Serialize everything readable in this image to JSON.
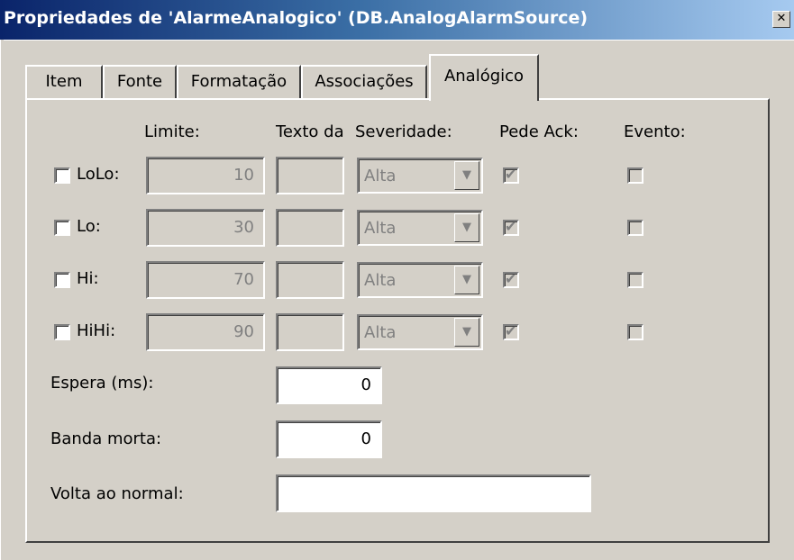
{
  "window": {
    "title": "Propriedades de 'AlarmeAnalogico' (DB.AnalogAlarmSource)",
    "close_glyph": "✕"
  },
  "tabs": [
    {
      "label": "Item"
    },
    {
      "label": "Fonte"
    },
    {
      "label": "Formatação"
    },
    {
      "label": "Associações"
    },
    {
      "label": "Analógico",
      "active": true
    }
  ],
  "headers": {
    "limit": "Limite:",
    "text": "Texto da",
    "severity": "Severidade:",
    "ack": "Pede Ack:",
    "event": "Evento:"
  },
  "rows": [
    {
      "label": "LoLo:",
      "limit": "10",
      "text": "",
      "severity": "Alta",
      "enabled": false,
      "ack": true,
      "event": false
    },
    {
      "label": "Lo:",
      "limit": "30",
      "text": "",
      "severity": "Alta",
      "enabled": false,
      "ack": true,
      "event": false
    },
    {
      "label": "Hi:",
      "limit": "70",
      "text": "",
      "severity": "Alta",
      "enabled": false,
      "ack": true,
      "event": false
    },
    {
      "label": "HiHi:",
      "limit": "90",
      "text": "",
      "severity": "Alta",
      "enabled": false,
      "ack": true,
      "event": false
    }
  ],
  "wait": {
    "label": "Espera (ms):",
    "value": "0"
  },
  "deadband": {
    "label": "Banda morta:",
    "value": "0"
  },
  "return_normal": {
    "label": "Volta ao normal:",
    "value": ""
  }
}
